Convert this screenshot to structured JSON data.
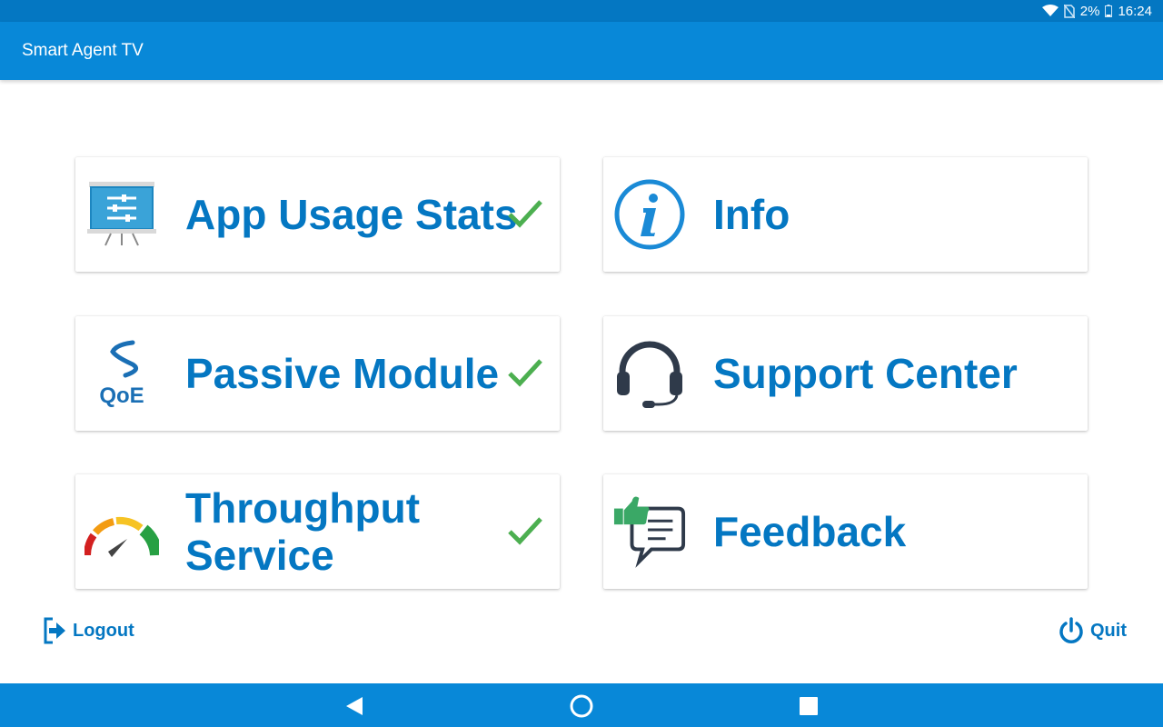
{
  "status_bar": {
    "battery": "2%",
    "time": "16:24",
    "icons": [
      "wifi-icon",
      "no-sim-icon",
      "battery-icon"
    ]
  },
  "app_bar": {
    "title": "Smart Agent TV"
  },
  "cards": [
    {
      "label": "App Usage Stats",
      "icon": "presentation-board-icon",
      "checked": true
    },
    {
      "label": "Info",
      "icon": "info-icon",
      "checked": false
    },
    {
      "label": "Passive Module",
      "icon": "qoe-icon",
      "checked": true
    },
    {
      "label": "Support Center",
      "icon": "headset-icon",
      "checked": false
    },
    {
      "label": "Throughput Service",
      "icon": "speedometer-icon",
      "checked": true
    },
    {
      "label": "Feedback",
      "icon": "feedback-icon",
      "checked": false
    }
  ],
  "qoe_text": "QoE",
  "footer": {
    "logout_label": "Logout",
    "quit_label": "Quit"
  },
  "nav": [
    "back-icon",
    "home-icon",
    "recents-icon"
  ],
  "colors": {
    "primary": "#0477c2",
    "app_bar": "#0888d8",
    "check": "#4caf50"
  }
}
